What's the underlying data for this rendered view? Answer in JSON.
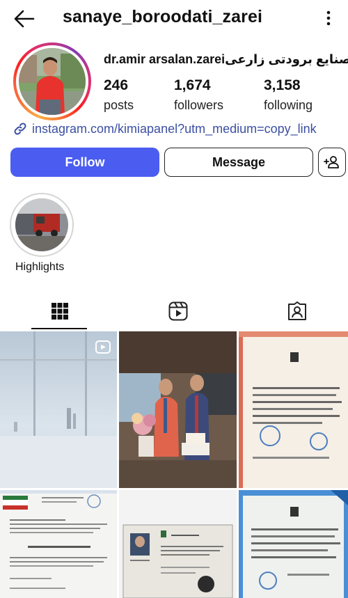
{
  "header": {
    "username": "sanaye_boroodati_zarei",
    "back_icon": "arrow-left-icon",
    "more_icon": "more-vertical-icon"
  },
  "profile": {
    "display_name": "dr.amir arsalan.zareiصنایع برودتی زارعی.",
    "stats": [
      {
        "value": "246",
        "label": "posts"
      },
      {
        "value": "1,674",
        "label": "followers"
      },
      {
        "value": "3,158",
        "label": "following"
      }
    ],
    "link": "instagram.com/kimiapanel?utm_medium=copy_link"
  },
  "actions": {
    "follow": "Follow",
    "message": "Message"
  },
  "highlights": {
    "label": "Highlights"
  },
  "tabs": [
    {
      "name": "grid",
      "icon": "grid-icon",
      "active": true
    },
    {
      "name": "reels",
      "icon": "reels-icon",
      "active": false
    },
    {
      "name": "tagged",
      "icon": "tagged-user-icon",
      "active": false
    }
  ],
  "colors": {
    "follow_button": "#4a5df0",
    "link": "#3b4fa3"
  }
}
